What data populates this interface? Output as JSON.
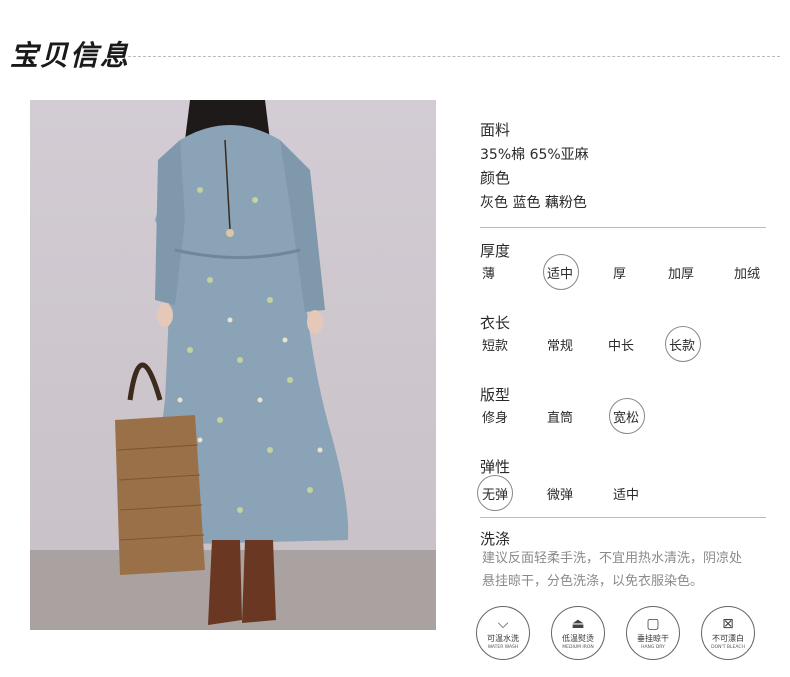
{
  "header": {
    "title": "宝贝信息"
  },
  "info": {
    "fabric_label": "面料",
    "fabric_value": "35%棉 65%亚麻",
    "color_label": "颜色",
    "color_value": "灰色 蓝色 藕粉色"
  },
  "thickness": {
    "label": "厚度",
    "options": [
      "薄",
      "适中",
      "厚",
      "加厚",
      "加绒"
    ],
    "selected": "适中"
  },
  "length": {
    "label": "衣长",
    "options": [
      "短款",
      "常规",
      "中长",
      "长款"
    ],
    "selected": "长款"
  },
  "fit": {
    "label": "版型",
    "options": [
      "修身",
      "直筒",
      "宽松"
    ],
    "selected": "宽松"
  },
  "elasticity": {
    "label": "弹性",
    "options": [
      "无弹",
      "微弹",
      "适中"
    ],
    "selected": "无弹"
  },
  "washing": {
    "label": "洗涤",
    "line1": "建议反面轻柔手洗，不宜用热水清洗，阴凉处",
    "line2": "悬挂晾干，分色洗涤，以免衣服染色。",
    "icons": [
      {
        "icon": "wash-basin-icon",
        "cn": "可温水洗",
        "en": "WATER WASH"
      },
      {
        "icon": "iron-icon",
        "cn": "低温熨烫",
        "en": "MEDIUM IRON"
      },
      {
        "icon": "hang-dry-icon",
        "cn": "垂挂晾干",
        "en": "HANG DRY"
      },
      {
        "icon": "no-bleach-icon",
        "cn": "不可漂白",
        "en": "DON'T BLEACH"
      }
    ]
  }
}
